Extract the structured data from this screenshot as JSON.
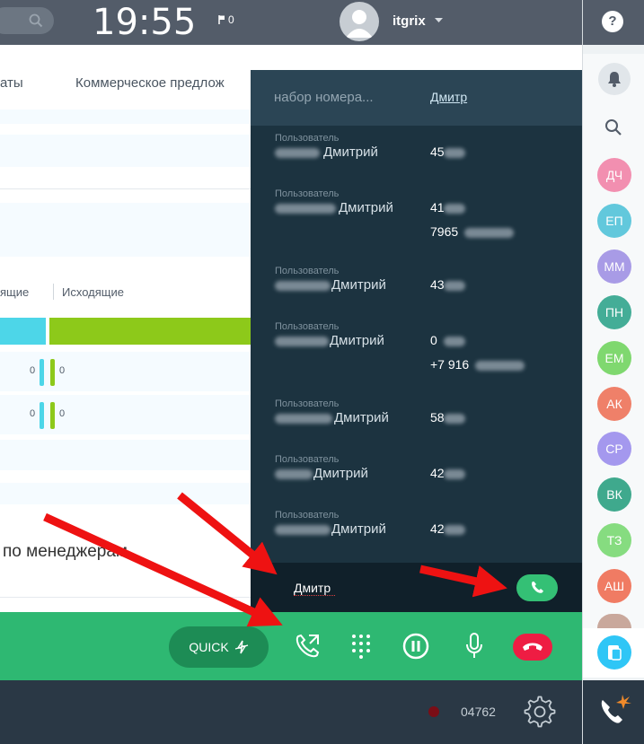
{
  "topbar": {
    "clock": "19:55",
    "flag_count": "0",
    "user_name": "itgrix"
  },
  "content": {
    "tab_1": "аты",
    "tab_2": "Коммерческое предлож",
    "col_incoming": "ящие",
    "col_outgoing": "Исходящие",
    "row1_left": "0",
    "row1_right": "0",
    "row2_left": "0",
    "row2_right": "0",
    "managers_title": "по менеджерам"
  },
  "dialer": {
    "status": "набор номера...",
    "name_link": "Дмитр",
    "entries": [
      {
        "type": "Пользователь",
        "name": "Дмитрий",
        "number": "45"
      },
      {
        "type": "Пользователь",
        "name": "Дмитрий",
        "number": "41",
        "number2": "7965"
      },
      {
        "type": "Пользователь",
        "name": "Дмитрий",
        "number": "43"
      },
      {
        "type": "Пользователь",
        "name": "Дмитрий",
        "number": "0",
        "number2": "+7 916"
      },
      {
        "type": "Пользователь",
        "name": "Дмитрий",
        "number": "58"
      },
      {
        "type": "Пользователь",
        "name": "Дмитрий",
        "number": "42"
      },
      {
        "type": "Пользователь",
        "name": "Дмитрий",
        "number": "42"
      }
    ],
    "input_value": "Дмитр"
  },
  "callbar": {
    "quick_label": "QUICK"
  },
  "bottombar": {
    "line_number": "04762"
  },
  "sidebar": {
    "help": "?",
    "contacts": [
      {
        "initials": "ДЧ",
        "color": "#f28fb0"
      },
      {
        "initials": "ЕП",
        "color": "#62c8dc"
      },
      {
        "initials": "ММ",
        "color": "#a89be6"
      },
      {
        "initials": "ПН",
        "color": "#44ad97"
      },
      {
        "initials": "ЕМ",
        "color": "#7fd86f"
      },
      {
        "initials": "АК",
        "color": "#ef8069"
      },
      {
        "initials": "СР",
        "color": "#a498ee"
      },
      {
        "initials": "ВК",
        "color": "#3fa98d"
      },
      {
        "initials": "ТЗ",
        "color": "#86dc80"
      },
      {
        "initials": "АШ",
        "color": "#f07b63"
      }
    ]
  },
  "colors": {
    "accent_green": "#2eb872",
    "dialer_bg": "#1c3340",
    "hangup_red": "#ee1d43",
    "arrow_red": "#ee1212"
  }
}
